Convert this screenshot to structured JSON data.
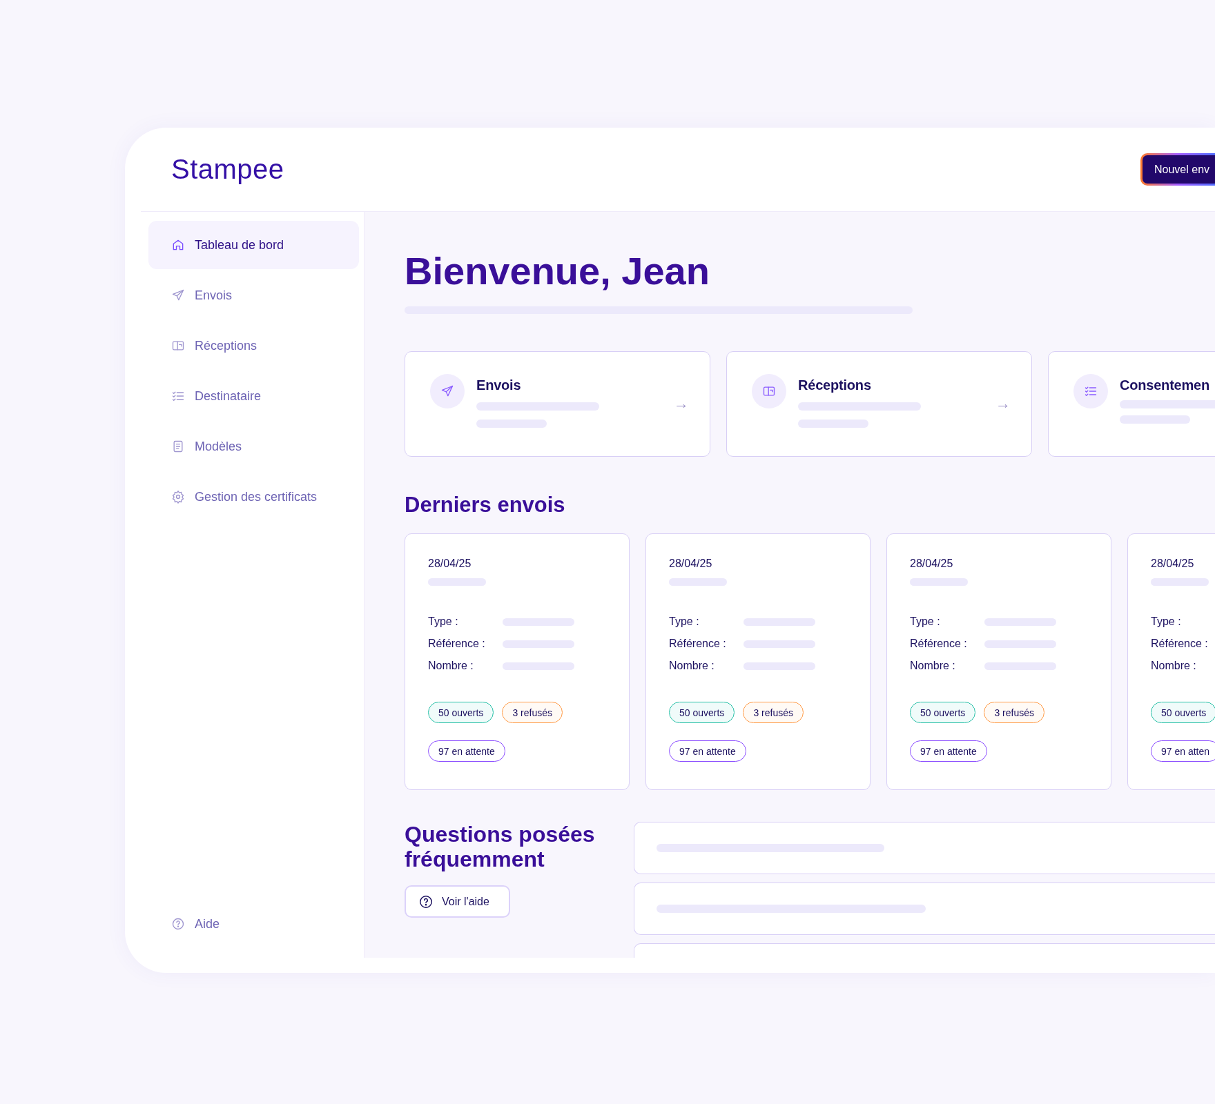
{
  "header": {
    "logo": "Stampee",
    "new_button": "Nouvel env"
  },
  "sidebar": {
    "items": [
      {
        "label": "Tableau de bord",
        "selected": true
      },
      {
        "label": "Envois",
        "selected": false
      },
      {
        "label": "Réceptions",
        "selected": false
      },
      {
        "label": "Destinataire",
        "selected": false
      },
      {
        "label": "Modèles",
        "selected": false
      },
      {
        "label": "Gestion des certificats",
        "selected": false
      }
    ],
    "help": "Aide"
  },
  "welcome": "Bienvenue, Jean",
  "shortcuts": [
    {
      "title": "Envois",
      "arrow": "→"
    },
    {
      "title": "Réceptions",
      "arrow": "→"
    },
    {
      "title": "Consentemen"
    }
  ],
  "recent": {
    "title": "Derniers envois",
    "cards": [
      {
        "date": "28/04/25",
        "fields": [
          "Type :",
          "Référence :",
          "Nombre :"
        ],
        "stats": [
          {
            "kind": "opened",
            "label": "50 ouverts"
          },
          {
            "kind": "refused",
            "label": "3 refusés"
          },
          {
            "kind": "pending",
            "label": "97 en attente"
          }
        ]
      },
      {
        "date": "28/04/25",
        "fields": [
          "Type :",
          "Référence :",
          "Nombre :"
        ],
        "stats": [
          {
            "kind": "opened",
            "label": "50 ouverts"
          },
          {
            "kind": "refused",
            "label": "3 refusés"
          },
          {
            "kind": "pending",
            "label": "97 en attente"
          }
        ]
      },
      {
        "date": "28/04/25",
        "fields": [
          "Type :",
          "Référence :",
          "Nombre :"
        ],
        "stats": [
          {
            "kind": "opened",
            "label": "50 ouverts"
          },
          {
            "kind": "refused",
            "label": "3 refusés"
          },
          {
            "kind": "pending",
            "label": "97 en attente"
          }
        ]
      },
      {
        "date": "28/04/25",
        "fields": [
          "Type :",
          "Référence :",
          "Nombre :"
        ],
        "stats": [
          {
            "kind": "opened",
            "label": "50 ouverts"
          },
          {
            "kind": "pending",
            "label": "97 en atten"
          }
        ]
      }
    ]
  },
  "faq": {
    "title": "Questions posées fréquemment",
    "button": "Voir l'aide"
  }
}
